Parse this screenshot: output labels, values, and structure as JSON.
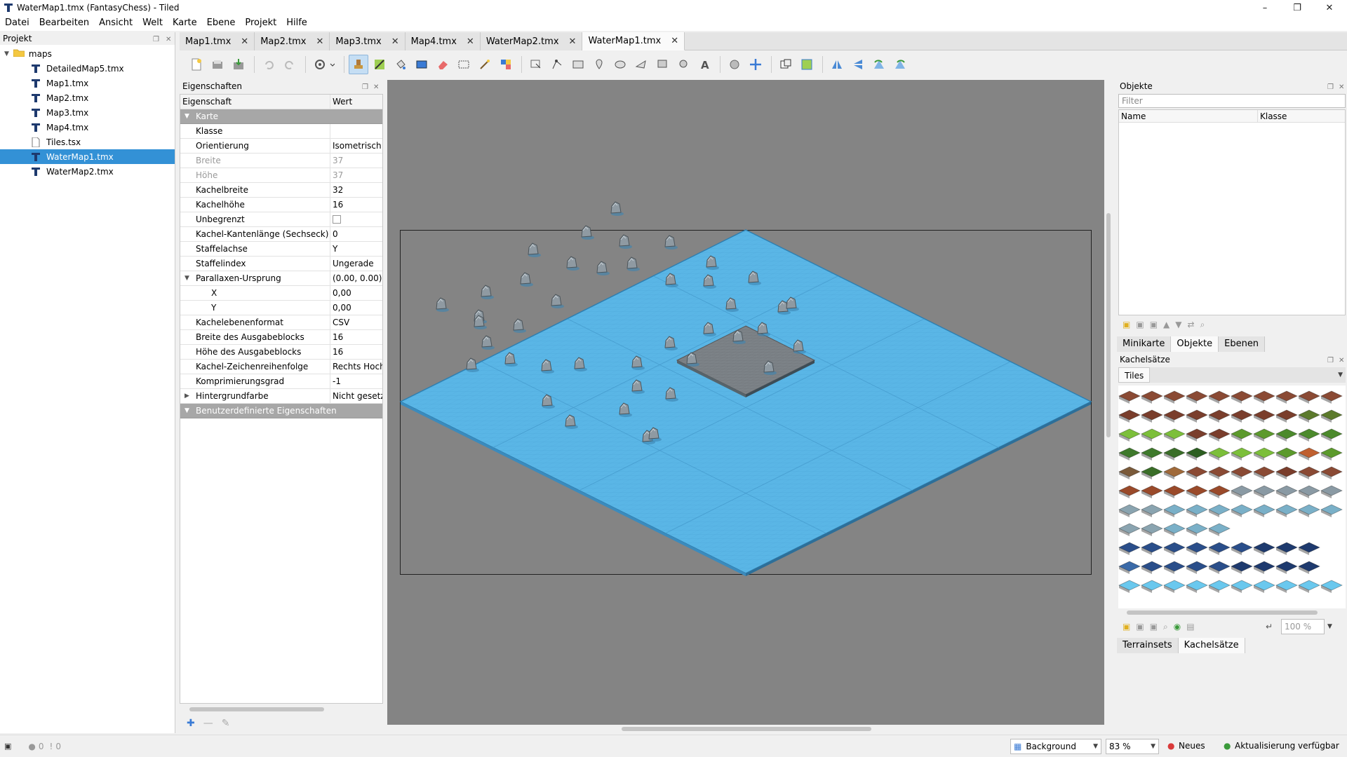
{
  "window": {
    "title": "WaterMap1.tmx (FantasyChess) - Tiled",
    "min": "–",
    "max": "❐",
    "close": "✕"
  },
  "menu": [
    "Datei",
    "Bearbeiten",
    "Ansicht",
    "Welt",
    "Karte",
    "Ebene",
    "Projekt",
    "Hilfe"
  ],
  "project": {
    "title": "Projekt",
    "folder": "maps",
    "files": [
      "DetailedMap5.tmx",
      "Map1.tmx",
      "Map2.tmx",
      "Map3.tmx",
      "Map4.tmx",
      "Tiles.tsx",
      "WaterMap1.tmx",
      "WaterMap2.tmx"
    ],
    "selected": "WaterMap1.tmx"
  },
  "tabs": [
    "Map1.tmx",
    "Map2.tmx",
    "Map3.tmx",
    "Map4.tmx",
    "WaterMap2.tmx",
    "WaterMap1.tmx"
  ],
  "active_tab": "WaterMap1.tmx",
  "properties": {
    "title": "Eigenschaften",
    "col_property": "Eigenschaft",
    "col_value": "Wert",
    "group_map": "Karte",
    "rows": [
      {
        "k": "Klasse",
        "v": ""
      },
      {
        "k": "Orientierung",
        "v": "Isometrisch"
      },
      {
        "k": "Breite",
        "v": "37"
      },
      {
        "k": "Höhe",
        "v": "37"
      },
      {
        "k": "Kachelbreite",
        "v": "32"
      },
      {
        "k": "Kachelhöhe",
        "v": "16"
      },
      {
        "k": "Unbegrenzt",
        "v": ""
      },
      {
        "k": "Kachel-Kantenlänge (Sechseck)",
        "v": "0"
      },
      {
        "k": "Staffelachse",
        "v": "Y"
      },
      {
        "k": "Staffelindex",
        "v": "Ungerade"
      },
      {
        "k": "Parallaxen-Ursprung",
        "v": "(0.00, 0.00)"
      },
      {
        "k": "X",
        "v": "0,00"
      },
      {
        "k": "Y",
        "v": "0,00"
      },
      {
        "k": "Kachelebenenformat",
        "v": "CSV"
      },
      {
        "k": "Breite des Ausgabeblocks",
        "v": "16"
      },
      {
        "k": "Höhe des Ausgabeblocks",
        "v": "16"
      },
      {
        "k": "Kachel-Zeichenreihenfolge",
        "v": "Rechts Hoch"
      },
      {
        "k": "Komprimierungsgrad",
        "v": "-1"
      },
      {
        "k": "Hintergrundfarbe",
        "v": "Nicht gesetzt"
      }
    ],
    "group_custom": "Benutzerdefinierte Eigenschaften"
  },
  "objects": {
    "title": "Objekte",
    "filter_placeholder": "Filter",
    "col_name": "Name",
    "col_class": "Klasse"
  },
  "mid_tabs": [
    "Minikarte",
    "Objekte",
    "Ebenen"
  ],
  "mid_active": "Objekte",
  "tilesets": {
    "title": "Kachelsätze",
    "tab": "Tiles",
    "zoom": "100 %"
  },
  "bottom_tabs": [
    "Terrainsets",
    "Kachelsätze"
  ],
  "bottom_active": "Kachelsätze",
  "status": {
    "errors": "0",
    "warnings": "0",
    "layer": "Background",
    "zoom": "83 %",
    "news": "Neues",
    "update": "Aktualisierung verfügbar"
  },
  "colors": {
    "water": "#5ab6e6",
    "selection": "#3391d6",
    "group_row": "#a7a7a7",
    "canvas": "#848484"
  }
}
